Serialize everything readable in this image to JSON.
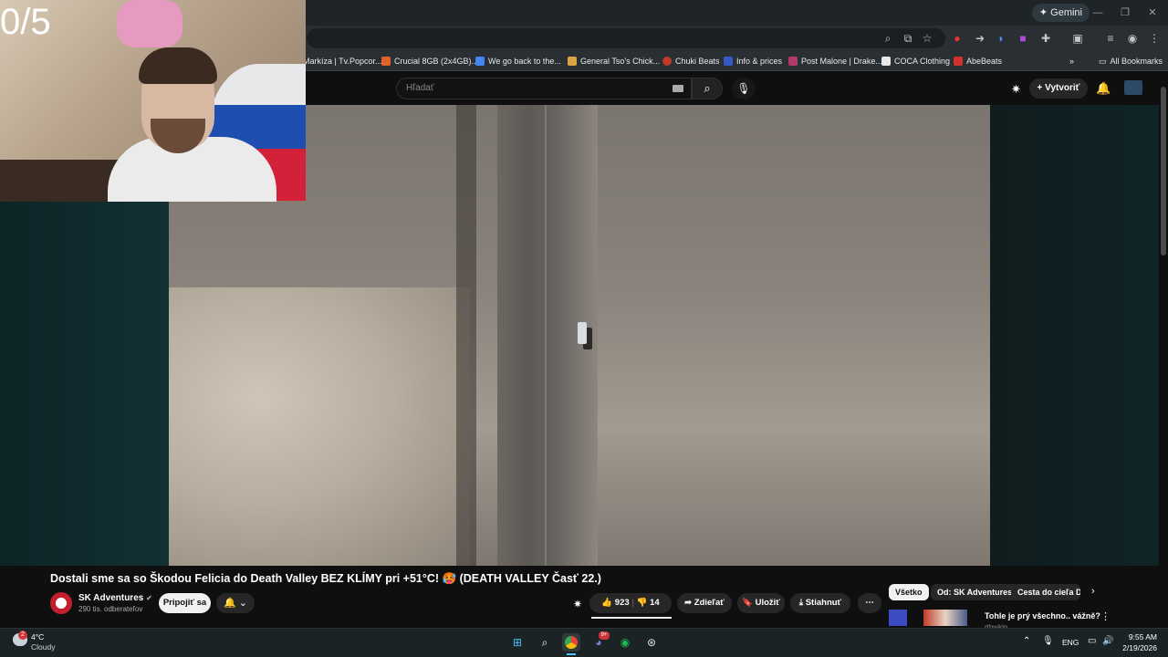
{
  "overlay": {
    "counter": "0/5"
  },
  "browser": {
    "gemini_label": "Gemini",
    "bookmarks": [
      {
        "label": "Markíza | Tv.Popcor...",
        "color": "#3a6fd8"
      },
      {
        "label": "Crucial 8GB (2x4GB)...",
        "color": "#e0632a"
      },
      {
        "label": "We go back to the...",
        "color": "#4285f4"
      },
      {
        "label": "General Tso's Chick...",
        "color": "#d9a441"
      },
      {
        "label": "Chuki Beats",
        "color": "#c0392b"
      },
      {
        "label": "Info & prices",
        "color": "#3658c9"
      },
      {
        "label": "Post Malone | Drake...",
        "color": "#b03a6a"
      },
      {
        "label": "COCA Clothing",
        "color": "#222222"
      },
      {
        "label": "AbeBeats",
        "color": "#d22f2f"
      }
    ],
    "all_bookmarks": "All Bookmarks"
  },
  "youtube": {
    "search_placeholder": "Hľadať",
    "create_label": "Vytvoriť",
    "video": {
      "title": "Dostali sme sa so Škodou Felicia do Death Valley BEZ KLÍMY pri +51°C! 🥵 (DEATH VALLEY Časť 22.)",
      "channel": "SK Adventures",
      "subscribers": "290 tis. odberateľov",
      "join_label": "Pripojiť sa",
      "likes": "923",
      "dislikes": "14",
      "share_label": "Zdieľať",
      "save_label": "Uložiť",
      "download_label": "Stiahnuť"
    },
    "chips": [
      "Všetko",
      "Od: SK Adventures",
      "Cesta do cieľa Do"
    ],
    "recommended": {
      "title": "Tohle je prý všechno.. vážně?",
      "channel": "rthwkin"
    }
  },
  "taskbar": {
    "weather_temp": "4°C",
    "weather_desc": "Cloudy",
    "weather_badge": "2",
    "lang": "ENG",
    "time": "9:55 AM",
    "date": "2/19/2026",
    "discord_badge": "9+"
  },
  "colors": {
    "accent_red": "#ff0033",
    "chip_active_bg": "#f1f1f1"
  }
}
